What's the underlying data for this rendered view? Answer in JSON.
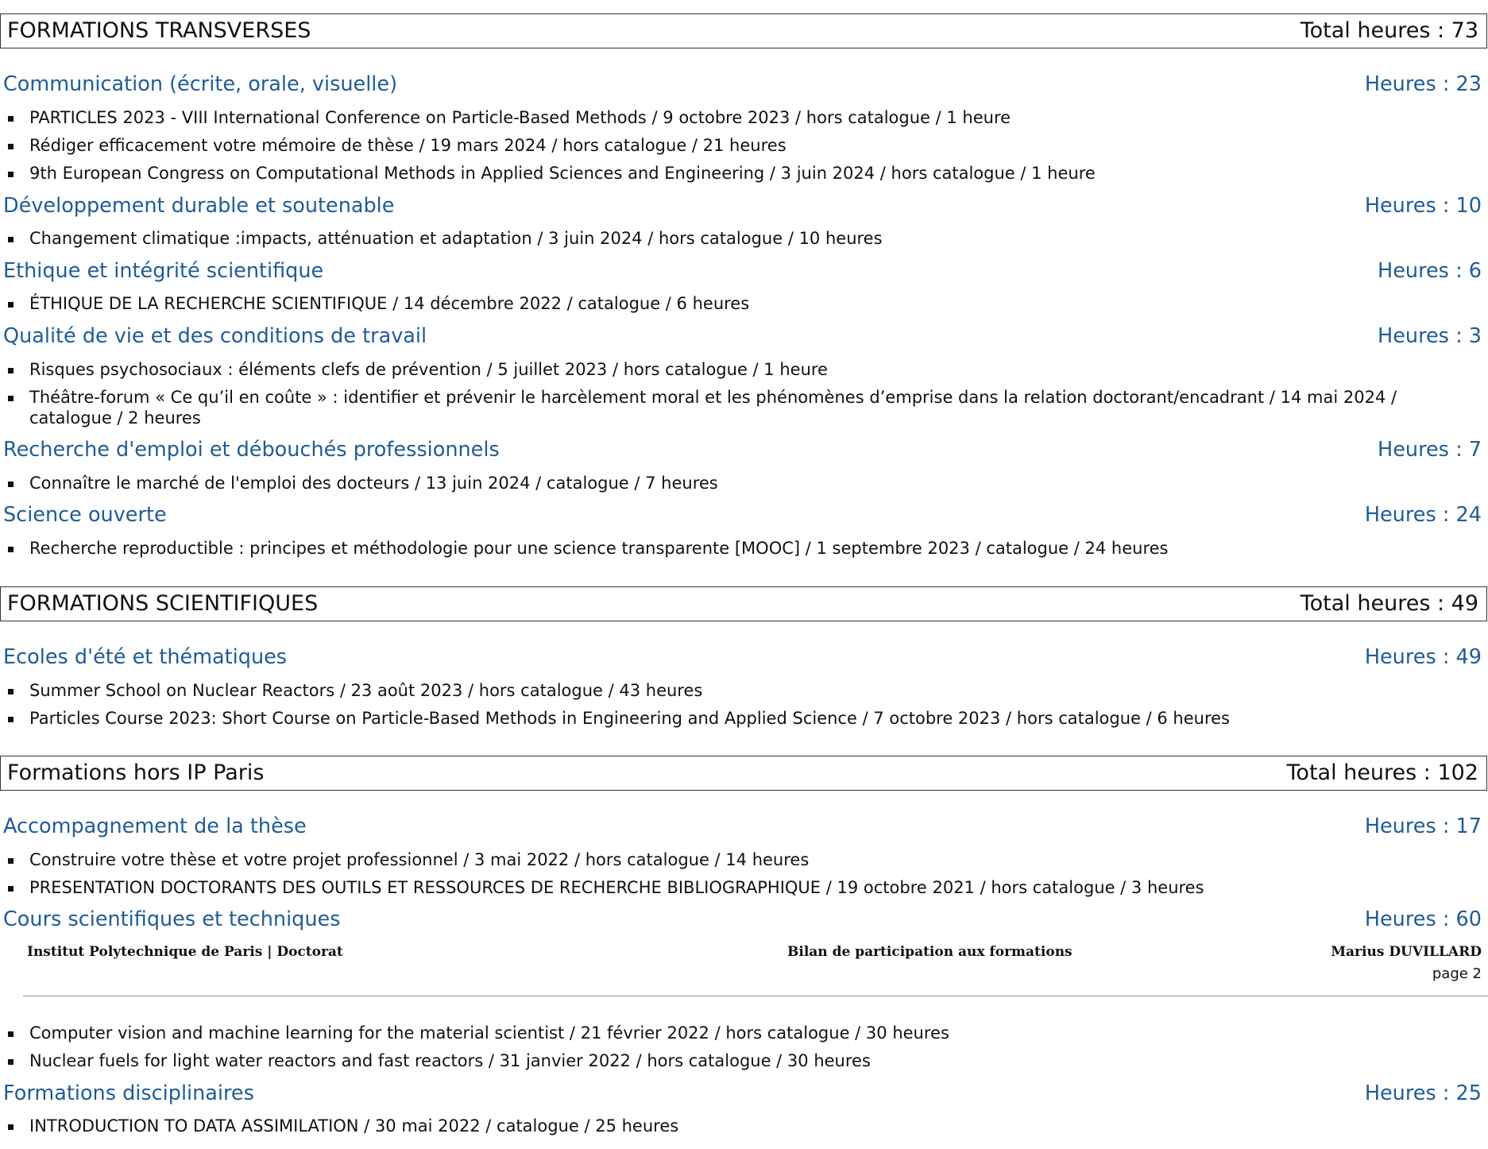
{
  "sections": [
    {
      "title": "FORMATIONS TRANSVERSES",
      "total": "Total heures : 73",
      "categories": [
        {
          "title": "Communication (écrite, orale, visuelle)",
          "hours": "Heures : 23",
          "items": [
            "PARTICLES 2023 - VIII International Conference on Particle-Based Methods / 9 octobre 2023 / hors catalogue / 1 heure",
            "Rédiger efficacement votre mémoire de thèse / 19 mars 2024 / hors catalogue / 21 heures",
            "9th European Congress on Computational Methods in Applied Sciences and Engineering / 3 juin 2024 / hors catalogue / 1 heure"
          ]
        },
        {
          "title": "Développement durable et soutenable",
          "hours": "Heures : 10",
          "items": [
            "Changement climatique :impacts, atténuation et adaptation / 3 juin 2024 / hors catalogue / 10 heures"
          ]
        },
        {
          "title": "Ethique et intégrité scientifique",
          "hours": "Heures : 6",
          "items": [
            "ÉTHIQUE DE LA RECHERCHE SCIENTIFIQUE / 14 décembre 2022 / catalogue / 6 heures"
          ]
        },
        {
          "title": "Qualité de vie et des conditions de travail",
          "hours": "Heures : 3",
          "items": [
            "Risques psychosociaux : éléments clefs de prévention / 5 juillet 2023 / hors catalogue / 1 heure",
            "Théâtre-forum « Ce qu’il en coûte » : identifier et prévenir le harcèlement moral et les phénomènes d’emprise dans la relation doctorant/encadrant / 14 mai 2024 / catalogue / 2 heures"
          ]
        },
        {
          "title": "Recherche d'emploi et débouchés professionnels",
          "hours": "Heures : 7",
          "items": [
            "Connaître le marché de l'emploi des docteurs / 13 juin 2024 / catalogue / 7 heures"
          ]
        },
        {
          "title": "Science ouverte",
          "hours": "Heures : 24",
          "items": [
            "Recherche reproductible : principes et méthodologie pour une science transparente [MOOC] / 1 septembre 2023 / catalogue / 24 heures"
          ]
        }
      ]
    },
    {
      "title": "FORMATIONS SCIENTIFIQUES",
      "total": "Total heures : 49",
      "categories": [
        {
          "title": "Ecoles d'été et thématiques",
          "hours": "Heures : 49",
          "items": [
            "Summer School on Nuclear Reactors / 23 août 2023 / hors catalogue / 43 heures",
            "Particles Course 2023: Short Course on Particle-Based Methods in Engineering and Applied Science / 7 octobre 2023 / hors catalogue / 6 heures"
          ]
        }
      ]
    },
    {
      "title": "Formations hors IP Paris",
      "total": "Total heures : 102",
      "categories": [
        {
          "title": "Accompagnement de la thèse",
          "hours": "Heures : 17",
          "items": [
            "Construire votre thèse et votre projet professionnel / 3 mai 2022 / hors catalogue / 14 heures",
            "PRESENTATION DOCTORANTS DES OUTILS ET RESSOURCES DE RECHERCHE BIBLIOGRAPHIQUE / 19 octobre 2021 / hors catalogue / 3 heures"
          ]
        },
        {
          "title": "Cours scientifiques et techniques",
          "hours": "Heures : 60",
          "items": [
            "Computer vision and machine learning for the material scientist / 21 février 2022 / hors catalogue / 30 heures",
            "Nuclear fuels for light water reactors and fast reactors / 31 janvier 2022 / hors catalogue / 30 heures"
          ]
        },
        {
          "title": "Formations disciplinaires",
          "hours": "Heures : 25",
          "items": [
            "INTRODUCTION TO DATA ASSIMILATION / 30 mai 2022 / catalogue / 25 heures"
          ]
        }
      ]
    }
  ],
  "footer": {
    "institution": "Institut Polytechnique de Paris | Doctorat",
    "document_title": "Bilan de participation aux formations",
    "person": "Marius DUVILLARD",
    "page": "page 2"
  }
}
